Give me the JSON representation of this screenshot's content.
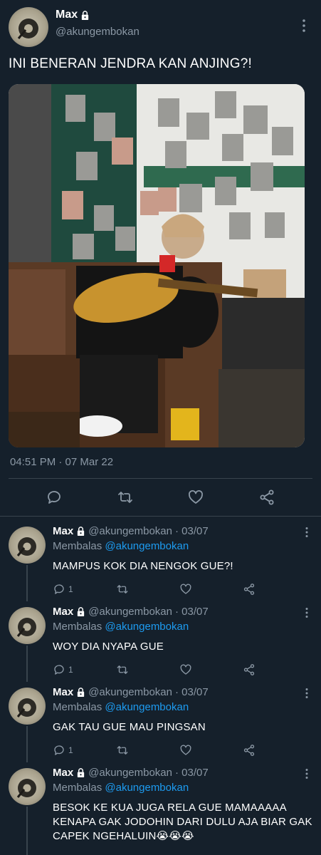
{
  "main": {
    "name": "Max",
    "handle": "@akungembokan",
    "text": "INI BENERAN JENDRA KAN ANJING?!",
    "timestamp": "04:51 PM · 07 Mar 22"
  },
  "replies": [
    {
      "name": "Max",
      "handle": "@akungembokan",
      "date": "· 03/07",
      "replying_prefix": "Membalas",
      "replying_to": "@akungembokan",
      "text": "MAMPUS KOK DIA NENGOK GUE?!",
      "reply_count": "1"
    },
    {
      "name": "Max",
      "handle": "@akungembokan",
      "date": "· 03/07",
      "replying_prefix": "Membalas",
      "replying_to": "@akungembokan",
      "text": "WOY DIA NYAPA GUE",
      "reply_count": "1"
    },
    {
      "name": "Max",
      "handle": "@akungembokan",
      "date": "· 03/07",
      "replying_prefix": "Membalas",
      "replying_to": "@akungembokan",
      "text": "GAK TAU GUE MAU PINGSAN",
      "reply_count": "1"
    },
    {
      "name": "Max",
      "handle": "@akungembokan",
      "date": "· 03/07",
      "replying_prefix": "Membalas",
      "replying_to": "@akungembokan",
      "text": "BESOK KE KUA JUGA RELA GUE MAMAAAAA KENAPA GAK JODOHIN DARI DULU AJA BIAR GAK CAPEK NGEHALUIN😭😭😭",
      "reply_count": ""
    }
  ],
  "icons": {
    "lock": "lock-icon",
    "more": "more-vertical-icon",
    "reply": "reply-icon",
    "retweet": "retweet-icon",
    "like": "heart-icon",
    "share": "share-icon"
  },
  "colors": {
    "background": "#15202b",
    "muted": "#8b98a5",
    "accent": "#1d9bf0",
    "divider": "#38444d"
  }
}
